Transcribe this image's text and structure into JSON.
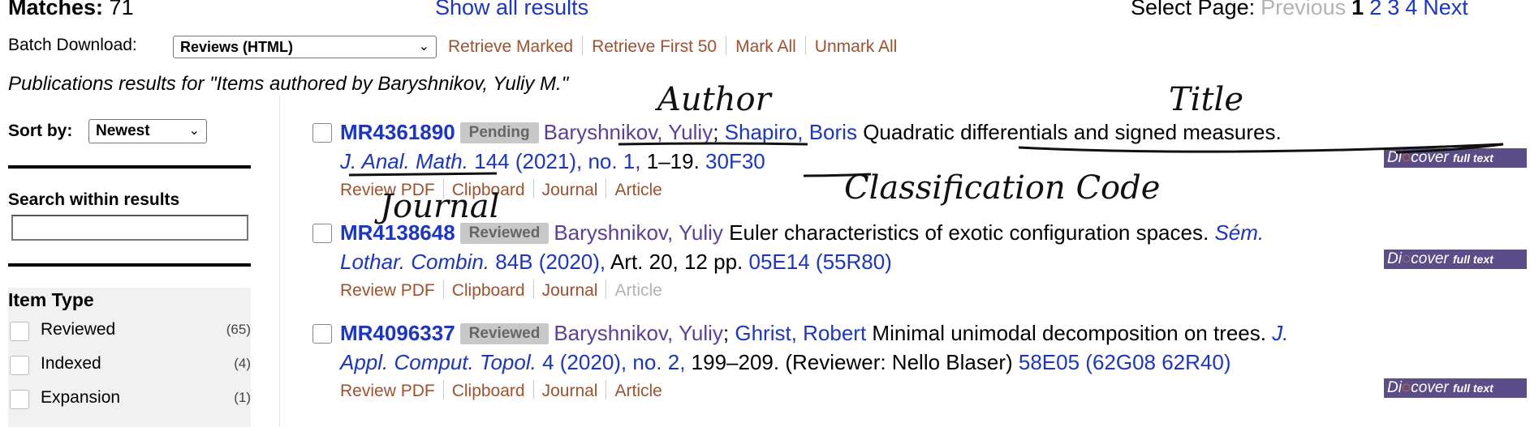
{
  "header": {
    "matches_label": "Matches:",
    "matches_count": "71",
    "show_all": "Show all results",
    "select_page_label": "Select Page:",
    "previous": "Previous",
    "pages": [
      "1",
      "2",
      "3",
      "4"
    ],
    "current_page": "1",
    "next": "Next"
  },
  "batch": {
    "label": "Batch Download:",
    "selected": "Reviews (HTML)",
    "links": [
      "Retrieve Marked",
      "Retrieve First 50",
      "Mark All",
      "Unmark All"
    ]
  },
  "heading": "Publications results for \"Items authored by Baryshnikov, Yuliy M.\"",
  "sidebar": {
    "sort_label": "Sort by:",
    "sort_value": "Newest",
    "search_label": "Search within results",
    "search_value": "",
    "facet_title": "Item Type",
    "facets": [
      {
        "label": "Reviewed",
        "count": "(65)"
      },
      {
        "label": "Indexed",
        "count": "(4)"
      },
      {
        "label": "Expansion",
        "count": "(1)"
      }
    ]
  },
  "results": [
    {
      "mr": "MR4361890",
      "status": "Pending",
      "authors": [
        "Baryshnikov, Yuliy",
        "Shapiro, Boris"
      ],
      "title": "Quadratic differentials and signed measures.",
      "journal": "J. Anal. Math.",
      "citation": "144 (2021), no. 1,",
      "pages": "1–19.",
      "classification": "30F30",
      "links": [
        "Review PDF",
        "Clipboard",
        "Journal",
        "Article"
      ],
      "article_enabled": true
    },
    {
      "mr": "MR4138648",
      "status": "Reviewed",
      "authors": [
        "Baryshnikov, Yuliy"
      ],
      "title": "Euler characteristics of exotic configuration spaces.",
      "journal_part1": "Sém.",
      "journal_part2": "Lothar. Combin.",
      "citation": "84B (2020),",
      "pages": "Art. 20, 12 pp.",
      "classification": "05E14 (55R80)",
      "links": [
        "Review PDF",
        "Clipboard",
        "Journal",
        "Article"
      ],
      "article_enabled": false
    },
    {
      "mr": "MR4096337",
      "status": "Reviewed",
      "authors": [
        "Baryshnikov, Yuliy",
        "Ghrist, Robert"
      ],
      "title": "Minimal unimodal decomposition on trees.",
      "journal_part1": "J.",
      "journal_part2": "Appl. Comput. Topol.",
      "citation": "4 (2020), no. 2,",
      "pages": "199–209. (Reviewer: Nello Blaser)",
      "classification": "58E05 (62G08 62R40)",
      "links": [
        "Review PDF",
        "Clipboard",
        "Journal",
        "Article"
      ],
      "article_enabled": true
    }
  ],
  "discover_badge": {
    "text1": "Di",
    "text2": "cover",
    "text3": "full text"
  },
  "annotations": {
    "author": "Author",
    "title": "Title",
    "journal": "Journal",
    "classification": "Classification Code"
  },
  "colors": {
    "link_blue": "#1a35cc",
    "author_purple": "#5a3f9e",
    "action_brown": "#a0512d",
    "badge_gray": "#c8c8c8",
    "discover_bg": "#5b4d88"
  }
}
